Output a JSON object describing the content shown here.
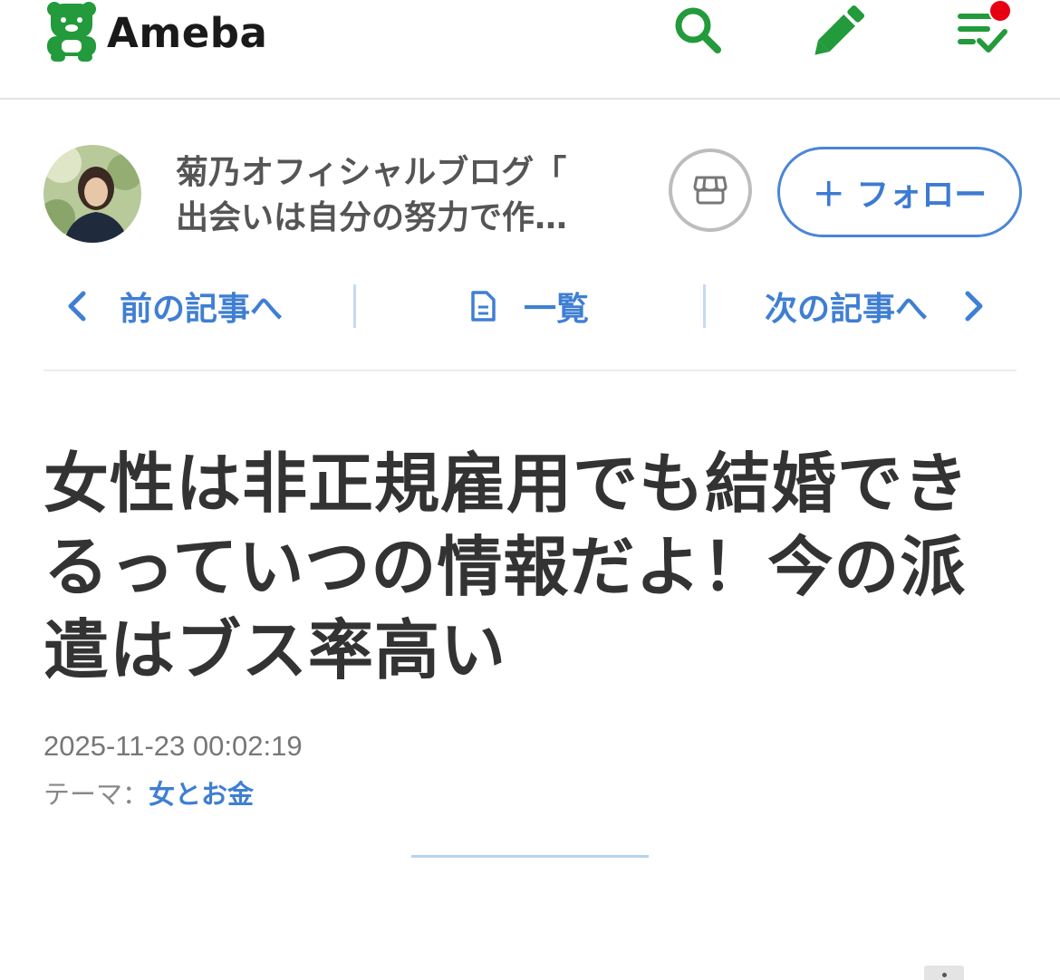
{
  "header": {
    "logo_text": "Ameba",
    "icons": [
      "ameba-bear-logo",
      "search-icon",
      "pen-icon",
      "checklist-icon"
    ],
    "brand_color": "#239a3b",
    "notification_color": "#e60012"
  },
  "blog": {
    "title_line1": "菊乃オフィシャルブログ「",
    "title_line2": "出会いは自分の努力で作…",
    "follow_label": "＋ フォロー",
    "accent_color": "#3f7fd3"
  },
  "nav": {
    "prev_label": "前の記事へ",
    "list_label": "一覧",
    "next_label": "次の記事へ"
  },
  "article": {
    "title": "女性は非正規雇用でも結婚できるっていつの情報だよ！今の派遣はブス率高い",
    "date": "2025-11-23 00:02:19",
    "theme_prefix": "テーマ：",
    "theme_link": "女とお金"
  }
}
